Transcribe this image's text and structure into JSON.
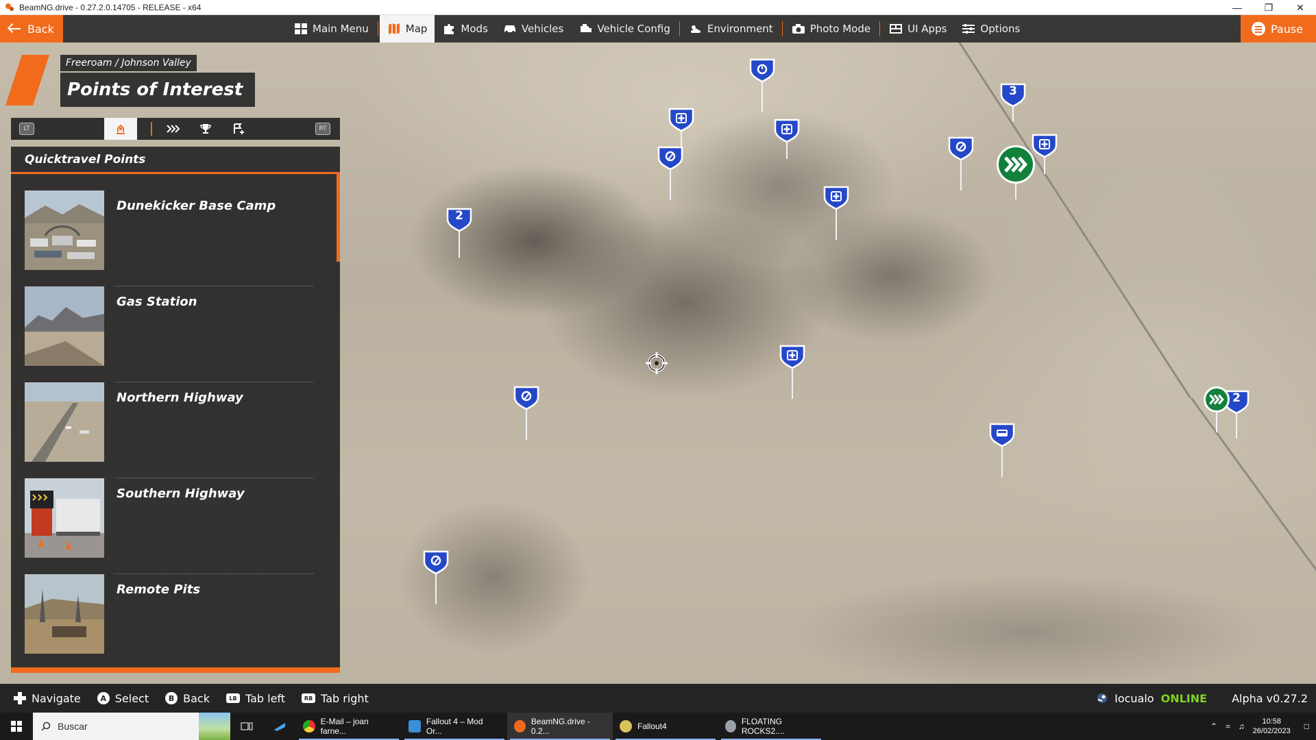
{
  "window": {
    "title": "BeamNG.drive - 0.27.2.0.14705 - RELEASE - x64"
  },
  "topbar": {
    "back_label": "Back",
    "menu": [
      {
        "label": "Main Menu",
        "icon": "grid-icon"
      },
      {
        "label": "Map",
        "icon": "map-icon",
        "active": true
      },
      {
        "label": "Mods",
        "icon": "puzzle-icon"
      },
      {
        "label": "Vehicles",
        "icon": "car-icon"
      },
      {
        "label": "Vehicle Config",
        "icon": "engine-icon"
      },
      {
        "label": "Environment",
        "icon": "weather-icon"
      },
      {
        "label": "Photo Mode",
        "icon": "camera-icon"
      },
      {
        "label": "UI Apps",
        "icon": "dashboard-icon"
      },
      {
        "label": "Options",
        "icon": "sliders-icon"
      }
    ],
    "pause_label": "Pause"
  },
  "header": {
    "breadcrumb": "Freeroam / Johnson Valley",
    "title": "Points of Interest"
  },
  "tabs": {
    "left_trigger": "LT",
    "right_trigger": "RT",
    "active_index": 0
  },
  "panel": {
    "heading": "Quicktravel Points",
    "items": [
      {
        "name": "Dunekicker Base Camp"
      },
      {
        "name": "Gas Station"
      },
      {
        "name": "Northern Highway"
      },
      {
        "name": "Southern Highway"
      },
      {
        "name": "Remote Pits"
      }
    ]
  },
  "map_markers": {
    "route_numbers": [
      "2",
      "3",
      "2"
    ]
  },
  "footer": {
    "hints": [
      {
        "key": "dpad",
        "label": "Navigate"
      },
      {
        "key": "A",
        "label": "Select"
      },
      {
        "key": "B",
        "label": "Back"
      },
      {
        "key": "LB",
        "label": "Tab left"
      },
      {
        "key": "RB",
        "label": "Tab right"
      }
    ],
    "username": "Iocualo",
    "status": "ONLINE",
    "version": "Alpha v0.27.2"
  },
  "taskbar": {
    "search_placeholder": "Buscar",
    "items": [
      {
        "label": "E-Mail – joan farne..."
      },
      {
        "label": "Fallout 4 – Mod Or..."
      },
      {
        "label": "BeamNG.drive - 0.2..."
      },
      {
        "label": "Fallout4"
      },
      {
        "label": "FLOATING ROCKS2...."
      }
    ],
    "time": "10:58",
    "date": "26/02/2023"
  },
  "colors": {
    "accent": "#f26b1d",
    "marker_blue": "#2548c8",
    "quicktravel_green": "#12813b",
    "online_green": "#7fd11d"
  }
}
